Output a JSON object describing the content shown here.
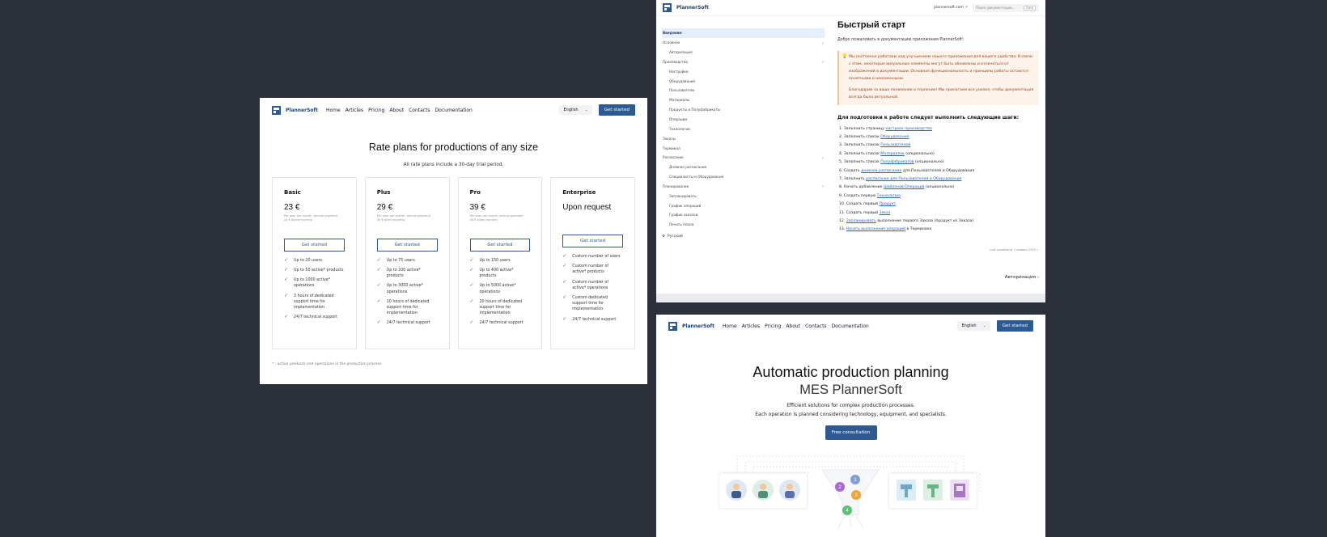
{
  "brand": {
    "name": "PlannerSoft"
  },
  "nav": {
    "links": [
      "Home",
      "Articles",
      "Pricing",
      "About",
      "Contacts",
      "Documentation"
    ],
    "language": "English",
    "cta": "Get started"
  },
  "pricing": {
    "title": "Rate plans for productions of any size",
    "subtitle": "All rate plans include a 30-day trial period.",
    "plans": [
      {
        "name": "Basic",
        "price": "23 €",
        "note1": "Per user per month, annual payment",
        "note2": "24 € billed monthly",
        "button": "Get started",
        "features": [
          "Up to 20 users",
          "Up to 50 active* products",
          "Up to 1000 active* operations",
          "3 hours of dedicated support time for implementation",
          "24/7 technical support"
        ]
      },
      {
        "name": "Plus",
        "price": "29 €",
        "note1": "Per user per month, annual payment",
        "note2": "34 € billed monthly",
        "button": "Get started",
        "features": [
          "Up to 75 users",
          "Up to 200 active* products",
          "Up to 3000 active* operations",
          "10 hours of dedicated support time for implementation",
          "24/7 technical support"
        ]
      },
      {
        "name": "Pro",
        "price": "39 €",
        "note1": "Per user per month, annual payment",
        "note2": "44 € billed monthly",
        "button": "Get started",
        "features": [
          "Up to 150 users",
          "Up to 400 active* products",
          "Up to 5000 active* operations",
          "20 hours of dedicated support time for implementation",
          "24/7 technical support"
        ]
      },
      {
        "name": "Enterprise",
        "price": "Upon request",
        "button": "Get started",
        "features": [
          "Custom number of users",
          "Custom number of active* products",
          "Custom number of active* operations",
          "Custom dedicated support time for implementation",
          "24/7 technical support"
        ]
      }
    ],
    "footnote": "* - active products and operations in the production process"
  },
  "docs": {
    "site_link": "plannersoft.com",
    "search_placeholder": "Поиск документации...",
    "search_kbd": "Ctrl K",
    "sidebar": [
      {
        "label": "Введение",
        "level": 0,
        "active": true
      },
      {
        "label": "Основное",
        "level": 0,
        "chevron": "⌄"
      },
      {
        "label": "Авторизация",
        "level": 1
      },
      {
        "label": "Производство",
        "level": 0,
        "chevron": "⌄"
      },
      {
        "label": "Настройки",
        "level": 1
      },
      {
        "label": "Оборудование",
        "level": 1
      },
      {
        "label": "Пользователи",
        "level": 1
      },
      {
        "label": "Материалы",
        "level": 1
      },
      {
        "label": "Продукты и Полуфабрикаты",
        "level": 1
      },
      {
        "label": "Операции",
        "level": 1
      },
      {
        "label": "Технологии",
        "level": 1
      },
      {
        "label": "Заказы",
        "level": 0
      },
      {
        "label": "Терминал",
        "level": 0
      },
      {
        "label": "Расписание",
        "level": 0,
        "chevron": "⌄"
      },
      {
        "label": "Дневное расписание",
        "level": 1
      },
      {
        "label": "Специалисты и Оборудование",
        "level": 1
      },
      {
        "label": "Планирование",
        "level": 0,
        "chevron": "⌄"
      },
      {
        "label": "Запланировать",
        "level": 1
      },
      {
        "label": "График операций",
        "level": 1
      },
      {
        "label": "График заказов",
        "level": 1
      },
      {
        "label": "Печать плана",
        "level": 1
      }
    ],
    "language": "Русский",
    "title": "Быстрый старт",
    "intro": "Добро пожаловать в документацию приложения PlannerSoft!",
    "callout": [
      "Мы постоянно работаем над улучшением нашего приложения для вашего удобства. В связи с этим, некоторые визуальные элементы могут быть обновлены и отличаться от изображений в документации. Основная функциональность и принципы работы остаются понятными и неизменными.",
      "Благодарим за ваше понимание и терпение! Мы прилагаем все усилия, чтобы документация всегда была актуальной."
    ],
    "steps_title": "Для подготовки к работе следует выполнить следующие шаги:",
    "steps": [
      {
        "num": "1.",
        "pre": "Заполнить страницу ",
        "link": "настроек производства",
        "post": ""
      },
      {
        "num": "2.",
        "pre": "Заполнить список ",
        "link": "Оборудования",
        "post": ""
      },
      {
        "num": "3.",
        "pre": "Заполнить список ",
        "link": "Пользователей",
        "post": ""
      },
      {
        "num": "4.",
        "pre": "Заполнить список ",
        "link": "Материалов",
        "post": " (опционально)"
      },
      {
        "num": "5.",
        "pre": "Заполнить список ",
        "link": "Полуфабрикатов",
        "post": " (опционально)"
      },
      {
        "num": "6.",
        "pre": "Создать ",
        "link": "дневное расписание",
        "post": " для Пользователей и Оборудования"
      },
      {
        "num": "7.",
        "pre": "Заполнить ",
        "link": "расписание для Пользователей и Оборудования",
        "post": ""
      },
      {
        "num": "8.",
        "pre": "Начать добавление ",
        "link": "Шаблонов Операций",
        "post": " (опционально)"
      },
      {
        "num": "9.",
        "pre": "Создать первую ",
        "link": "Технологию",
        "post": ""
      },
      {
        "num": "10.",
        "pre": "Создать первый ",
        "link": "Продукт",
        "post": ""
      },
      {
        "num": "11.",
        "pre": "Создать первый ",
        "link": "Заказ",
        "post": ""
      },
      {
        "num": "12.",
        "pre": "",
        "link": "Запланировать",
        "post": " выполнение первого Заказа (продукт из Заказа)"
      },
      {
        "num": "13.",
        "pre": "",
        "link": "Начать выполнение операций",
        "post": " в Терминале"
      }
    ],
    "updated": "Last updated at 1 января 2025 г.",
    "next": "Авторизация"
  },
  "landing": {
    "title_1": "Automatic production planning",
    "title_2": "MES PlannerSoft",
    "sub_1": "Efficient solutions for complex production processes.",
    "sub_2": "Each operation is planned considering technology, equipment, and specialists.",
    "cta": "Free consultation",
    "funnel_numbers": [
      "1",
      "2",
      "3",
      "4"
    ]
  },
  "colors": {
    "primary": "#2d5b91",
    "link": "#2563b7",
    "callout_bg": "#fdf3ea",
    "callout_text": "#9a3e12",
    "check": "#3f7d5a",
    "background": "#2b303b"
  }
}
